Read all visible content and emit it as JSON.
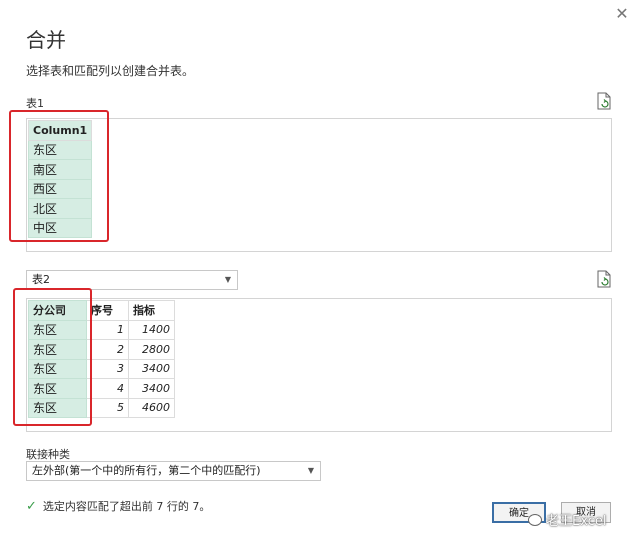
{
  "dialog": {
    "close_glyph": "✕",
    "title": "合并",
    "subtitle": "选择表和匹配列以创建合并表。"
  },
  "table1": {
    "label": "表1",
    "header": "Column1",
    "rows": [
      "东区",
      "南区",
      "西区",
      "北区",
      "中区"
    ]
  },
  "table2": {
    "selected": "表2",
    "headers": [
      "分公司",
      "序号",
      "指标"
    ],
    "rows": [
      [
        "东区",
        "1",
        "1400"
      ],
      [
        "东区",
        "2",
        "2800"
      ],
      [
        "东区",
        "3",
        "3400"
      ],
      [
        "东区",
        "4",
        "3400"
      ],
      [
        "东区",
        "5",
        "4600"
      ]
    ]
  },
  "join": {
    "label": "联接种类",
    "selected": "左外部(第一个中的所有行，第二个中的匹配行)"
  },
  "status": {
    "text": "选定内容匹配了超出前 7 行的 7。"
  },
  "buttons": {
    "ok": "确定",
    "cancel": "取消"
  },
  "watermark": "老王Excel",
  "colors": {
    "selection_fill": "#d6ede3",
    "annotation_red": "#d9262b",
    "check_green": "#3a9d4a"
  },
  "icons": {
    "refresh": "refresh-icon",
    "dropdown": "chevron-down-icon",
    "check": "check-icon",
    "close": "close-icon"
  }
}
